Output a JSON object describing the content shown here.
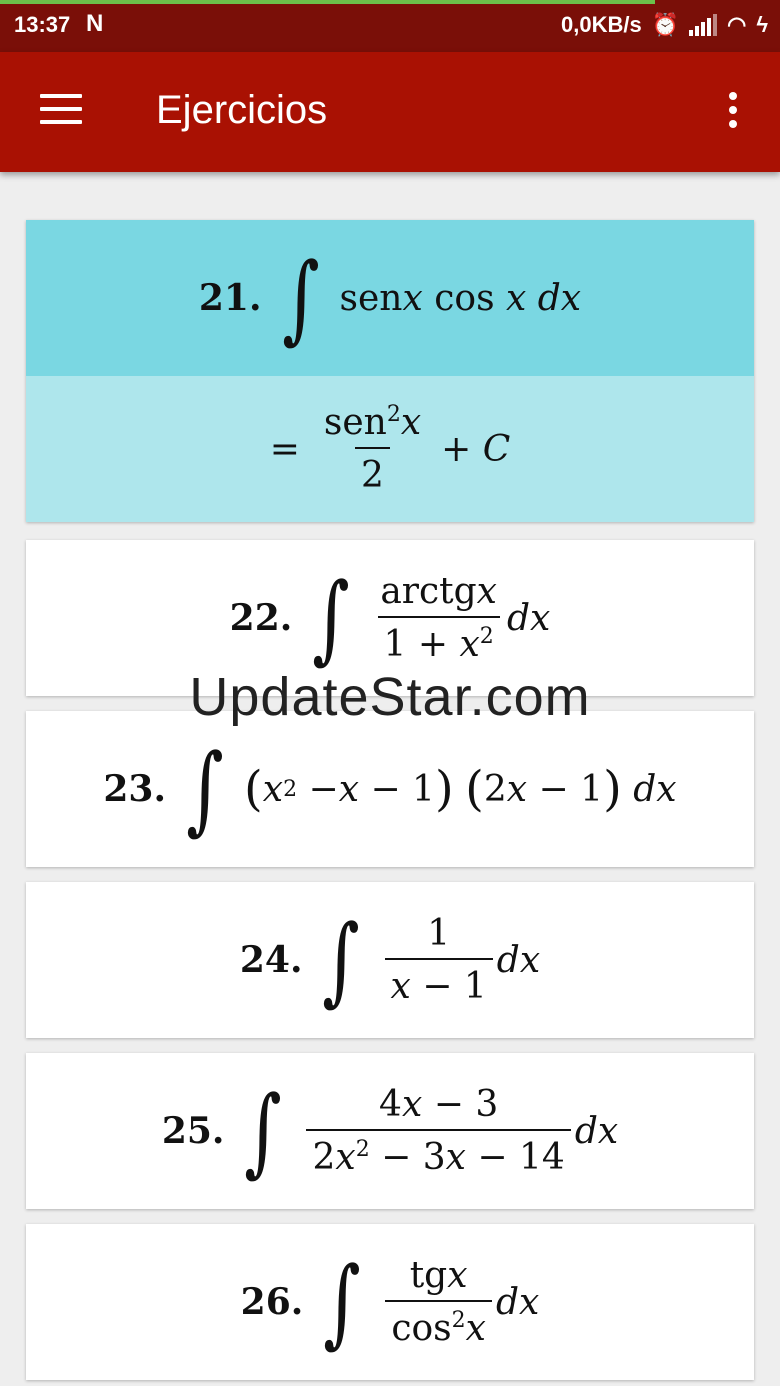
{
  "status_bar": {
    "time": "13:37",
    "network_speed": "0,0KB/s",
    "progress_fraction": 0.84
  },
  "app_bar": {
    "title": "Ejercicios"
  },
  "exercises": [
    {
      "number": "21.",
      "integrand": "senx cos x dx",
      "answer": "= sen²x / 2 + C",
      "active": true
    },
    {
      "number": "22.",
      "integrand": "arctgx / (1 + x²) dx"
    },
    {
      "number": "23.",
      "integrand": "(x² − x − 1)(2x − 1) dx"
    },
    {
      "number": "24.",
      "integrand": "1 / (x − 1) dx"
    },
    {
      "number": "25.",
      "integrand": "(4x − 3) / (2x² − 3x − 14) dx"
    },
    {
      "number": "26.",
      "integrand": "tgx / cos²x dx"
    }
  ],
  "watermark": "UpdateStar.com",
  "colors": {
    "status_bar": "#7a0f08",
    "app_bar": "#a91103",
    "active_question": "#7ad7e2",
    "active_answer": "#aee6ec"
  }
}
